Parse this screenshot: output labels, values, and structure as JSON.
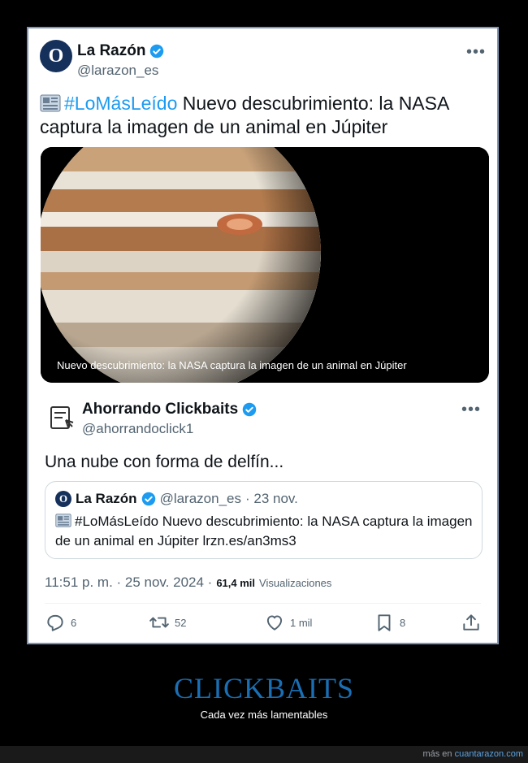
{
  "post": {
    "author_name": "La Razón",
    "author_handle": "@larazon_es",
    "avatar_letter": "O",
    "hashtag": "#LoMásLeído",
    "text": " Nuevo descubrimiento: la NASA captura la imagen de un animal en Júpiter",
    "media_caption": "Nuevo descubrimiento: la NASA captura la imagen de un animal en Júpiter"
  },
  "reply": {
    "author_name": "Ahorrando Clickbaits",
    "author_handle": "@ahorrandoclick1",
    "text": "Una nube con forma de delfín...",
    "quote": {
      "author_name": "La Razón",
      "author_handle": "@larazon_es",
      "date": "· 23 nov.",
      "text": "#LoMásLeído Nuevo descubrimiento: la NASA captura la imagen de un animal en Júpiter lrzn.es/an3ms3"
    },
    "timestamp": "11:51 p. m. · 25 nov. 2024 ·",
    "views_count": "61,4 mil",
    "views_label": "Visualizaciones",
    "replies": "6",
    "reposts": "52",
    "likes": "1 mil",
    "bookmarks": "8"
  },
  "page": {
    "title": "CLICKBAITS",
    "subtitle": "Cada vez más lamentables",
    "footer_prefix": "más en",
    "footer_link": "cuantarazon.com"
  },
  "colors": {
    "accent": "#1d9bf0",
    "title": "#1a6fb4",
    "frame_border": "#7f95b5"
  }
}
